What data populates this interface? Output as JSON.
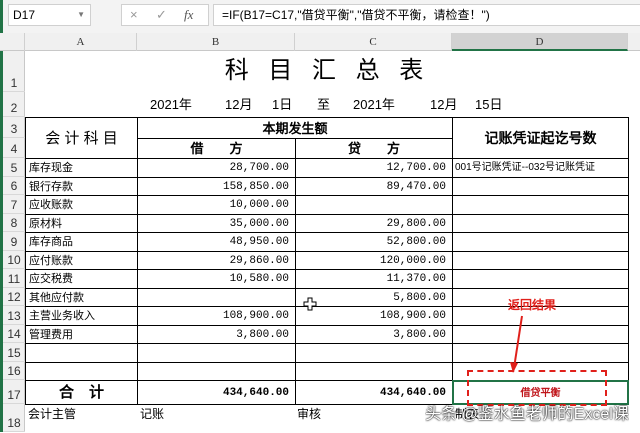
{
  "formula_bar": {
    "name_box": "D17",
    "cancel": "×",
    "enter": "✓",
    "fx": "fx",
    "formula": "=IF(B17=C17,\"借贷平衡\",\"借贷不平衡，请检查！\")"
  },
  "columns": [
    "A",
    "B",
    "C",
    "D"
  ],
  "rows_numbers": [
    "1",
    "2",
    "3",
    "4",
    "5",
    "6",
    "7",
    "8",
    "9",
    "10",
    "11",
    "12",
    "13",
    "14",
    "15",
    "16",
    "17",
    "18"
  ],
  "title": "科 目 汇 总 表",
  "date_range": {
    "y1": "2021年",
    "m1": "12月",
    "d1": "1日",
    "to": "至",
    "y2": "2021年",
    "m2": "12月",
    "d2": "15日"
  },
  "headers": {
    "account": "会 计 科 目",
    "period": "本期发生额",
    "debit": "借　　方",
    "credit": "贷　　方",
    "voucher": "记账凭证起讫号数"
  },
  "rows": [
    {
      "account": "库存现金",
      "debit": "28,700.00",
      "credit": "12,700.00",
      "voucher": "001号记账凭证--032号记账凭证"
    },
    {
      "account": "银行存款",
      "debit": "158,850.00",
      "credit": "89,470.00",
      "voucher": ""
    },
    {
      "account": "应收账款",
      "debit": "10,000.00",
      "credit": "",
      "voucher": ""
    },
    {
      "account": "原材料",
      "debit": "35,000.00",
      "credit": "29,800.00",
      "voucher": ""
    },
    {
      "account": "库存商品",
      "debit": "48,950.00",
      "credit": "52,800.00",
      "voucher": ""
    },
    {
      "account": "应付账款",
      "debit": "29,860.00",
      "credit": "120,000.00",
      "voucher": ""
    },
    {
      "account": "应交税费",
      "debit": "10,580.00",
      "credit": "11,370.00",
      "voucher": ""
    },
    {
      "account": "其他应付款",
      "debit": "",
      "credit": "5,800.00",
      "voucher": ""
    },
    {
      "account": "主营业务收入",
      "debit": "108,900.00",
      "credit": "108,900.00",
      "voucher": ""
    },
    {
      "account": "管理费用",
      "debit": "3,800.00",
      "credit": "3,800.00",
      "voucher": ""
    },
    {
      "account": "",
      "debit": "",
      "credit": "",
      "voucher": ""
    },
    {
      "account": "",
      "debit": "",
      "credit": "",
      "voucher": ""
    }
  ],
  "total": {
    "label": "合　计",
    "debit": "434,640.00",
    "credit": "434,640.00",
    "result": "借贷平衡"
  },
  "footer": {
    "supervisor": "会计主管",
    "bookkeeping": "记账",
    "review": "审核",
    "preparer": "制表"
  },
  "annotation": "返回结果",
  "watermark": "头条 @鉴水鱼老师的Excel课",
  "colors": {
    "accent": "#217346",
    "annotation": "#e0201b"
  }
}
